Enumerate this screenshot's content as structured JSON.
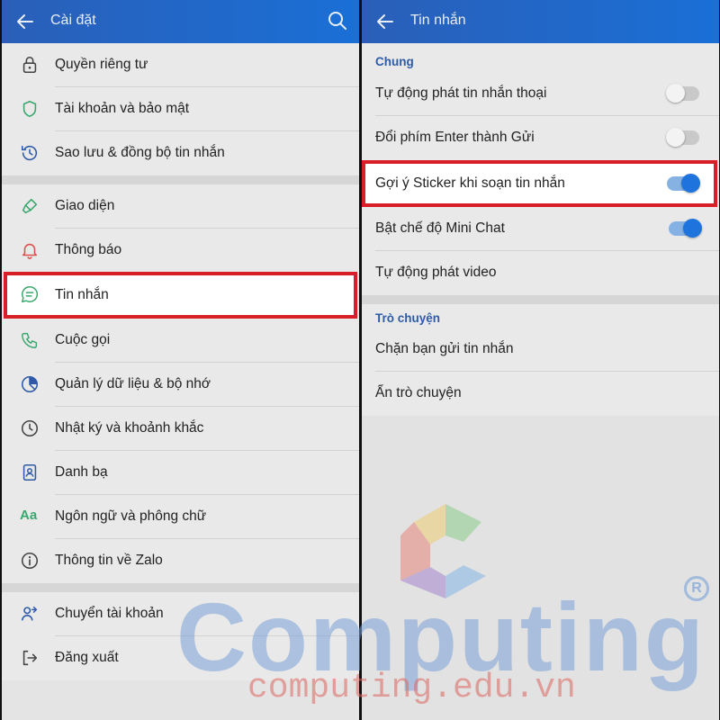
{
  "left": {
    "appbar": {
      "title": "Cài đặt"
    },
    "items": [
      {
        "label": "Quyền riêng tư",
        "icon": "lock-icon"
      },
      {
        "label": "Tài khoản và bảo mật",
        "icon": "shield-icon"
      },
      {
        "label": "Sao lưu & đồng bộ tin nhắn",
        "icon": "history-clock-icon"
      },
      {
        "label": "Giao diện",
        "icon": "paint-brush-icon"
      },
      {
        "label": "Thông báo",
        "icon": "bell-icon"
      },
      {
        "label": "Tin nhắn",
        "icon": "chat-bubble-icon"
      },
      {
        "label": "Cuộc gọi",
        "icon": "phone-icon"
      },
      {
        "label": "Quản lý dữ liệu & bộ nhớ",
        "icon": "pie-chart-icon"
      },
      {
        "label": "Nhật ký và khoảnh khắc",
        "icon": "clock-icon"
      },
      {
        "label": "Danh bạ",
        "icon": "contacts-icon"
      },
      {
        "label": "Ngôn ngữ và phông chữ",
        "icon": "language-icon",
        "icon_text": "Aa"
      },
      {
        "label": "Thông tin về Zalo",
        "icon": "info-icon"
      },
      {
        "label": "Chuyển tài khoản",
        "icon": "switch-account-icon"
      },
      {
        "label": "Đăng xuất",
        "icon": "logout-icon"
      }
    ]
  },
  "right": {
    "appbar": {
      "title": "Tin nhắn"
    },
    "section_general": "Chung",
    "section_chat": "Trò chuyện",
    "general_items": [
      {
        "label": "Tự động phát tin nhắn thoại",
        "toggle": false
      },
      {
        "label": "Đổi phím Enter thành Gửi",
        "toggle": false
      },
      {
        "label": "Gợi ý Sticker khi soạn tin nhắn",
        "toggle": true
      },
      {
        "label": "Bật chế độ Mini Chat",
        "toggle": true
      },
      {
        "label": "Tự động phát video"
      }
    ],
    "chat_items": [
      {
        "label": "Chặn bạn gửi tin nhắn"
      },
      {
        "label": "Ẩn trò chuyện"
      }
    ]
  },
  "watermark": {
    "brand": "Computing",
    "url": "computing.edu.vn",
    "registered": "R"
  },
  "colors": {
    "appbar": "#1a6fd6",
    "highlight": "#d61f26",
    "toggle_on": "#1f73dd",
    "section_header": "#2c5ca8"
  }
}
